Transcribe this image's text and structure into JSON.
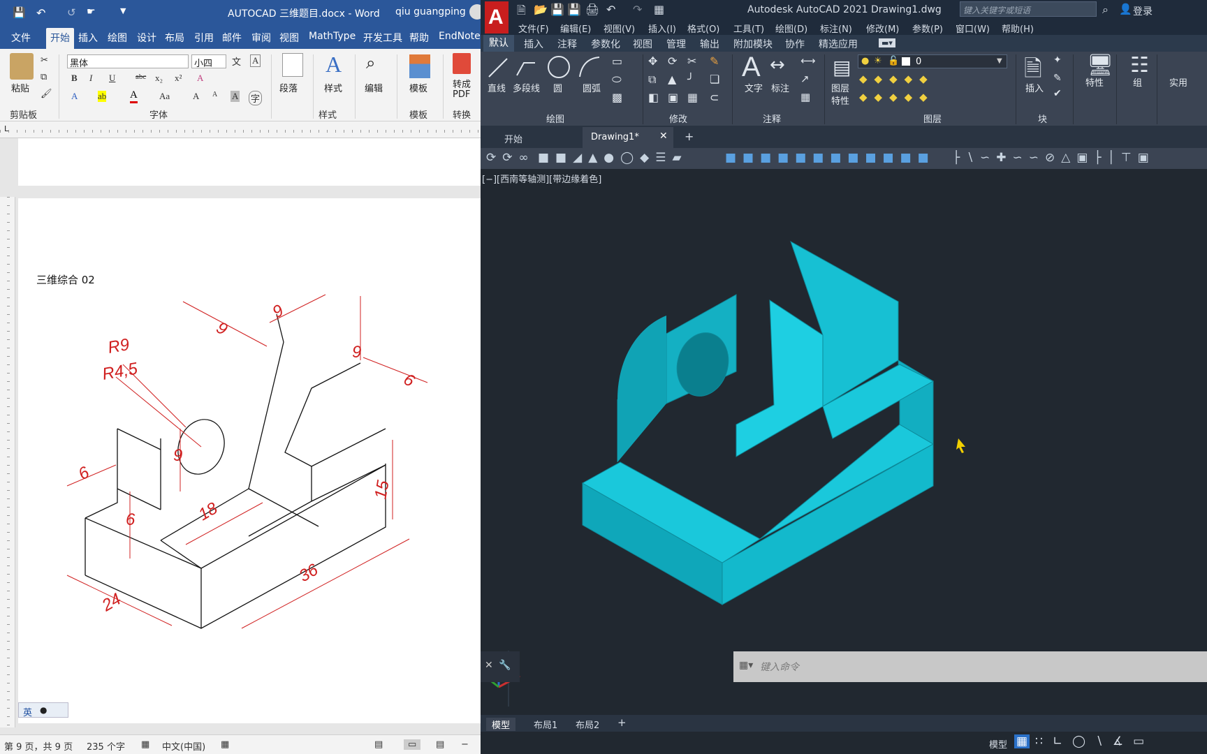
{
  "word": {
    "title": "AUTOCAD 三维题目.docx  -  Word",
    "user": "qiu guangping",
    "tabs": [
      "文件",
      "开始",
      "插入",
      "绘图",
      "设计",
      "布局",
      "引用",
      "邮件",
      "审阅",
      "视图",
      "MathType",
      "开发工具",
      "帮助",
      "EndNote"
    ],
    "active_tab": "开始",
    "ribbon": {
      "paste": "粘贴",
      "font_name": "黑体",
      "font_size": "小四",
      "paragraph": "段落",
      "styles": "样式",
      "edit": "编辑",
      "template": "模板",
      "to_pdf_1": "转成",
      "to_pdf_2": "PDF",
      "groups": {
        "clipboard": "剪贴板",
        "font": "字体",
        "style": "样式",
        "template": "模板",
        "convert": "转换"
      }
    },
    "doc_heading": "三维综合 02",
    "ime": "英",
    "status": {
      "page": "第 9 页，共 9 页",
      "words": "235 个字",
      "lang": "中文(中国)"
    }
  },
  "drawing": {
    "dims": [
      "R9",
      "R4,5",
      "9",
      "9",
      "9",
      "6",
      "9",
      "15",
      "6",
      "18",
      "6",
      "24",
      "36"
    ]
  },
  "acad": {
    "title": "Autodesk AutoCAD 2021    Drawing1.dwg",
    "search_placeholder": "键入关键字或短语",
    "login": "登录",
    "menu": [
      "文件(F)",
      "编辑(E)",
      "视图(V)",
      "插入(I)",
      "格式(O)",
      "工具(T)",
      "绘图(D)",
      "标注(N)",
      "修改(M)",
      "参数(P)",
      "窗口(W)",
      "帮助(H)"
    ],
    "ribbon_tabs": [
      "默认",
      "插入",
      "注释",
      "参数化",
      "视图",
      "管理",
      "输出",
      "附加模块",
      "协作",
      "精选应用"
    ],
    "active_ribbon_tab": "默认",
    "draw_tools": [
      "直线",
      "多段线",
      "圆",
      "圆弧"
    ],
    "annot_tools": [
      "文字",
      "标注"
    ],
    "layer_tools": [
      "图层",
      "特性"
    ],
    "layer_value": "0",
    "block_tools": [
      "插入"
    ],
    "props": "特性",
    "group": "组",
    "practical": "实用",
    "panels": {
      "draw": "绘图",
      "modify": "修改",
      "annot": "注释",
      "layer": "图层",
      "block": "块"
    },
    "file_tabs": [
      "开始",
      "Drawing1*"
    ],
    "view_label": "[−][西南等轴测][带边缘着色]",
    "cmd_placeholder": "键入命令",
    "layout_tabs": [
      "模型",
      "布局1",
      "布局2"
    ],
    "status_model": "模型",
    "solid_color": "#17b3c6"
  }
}
